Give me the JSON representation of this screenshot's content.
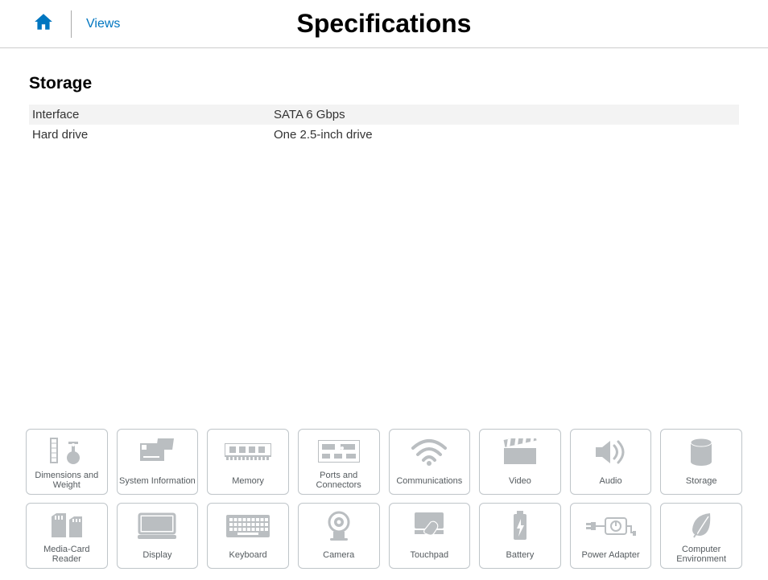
{
  "header": {
    "views_link": "Views",
    "title": "Specifications"
  },
  "section": {
    "title": "Storage",
    "rows": [
      {
        "key": "Interface",
        "value": "SATA 6 Gbps"
      },
      {
        "key": "Hard drive",
        "value": "One 2.5-inch drive"
      }
    ]
  },
  "nav": {
    "row1": [
      {
        "label": "Dimensions and Weight",
        "icon": "dimensions-weight-icon"
      },
      {
        "label": "System Information",
        "icon": "system-info-icon"
      },
      {
        "label": "Memory",
        "icon": "memory-icon"
      },
      {
        "label": "Ports and Connectors",
        "icon": "ports-icon"
      },
      {
        "label": "Communications",
        "icon": "wifi-icon"
      },
      {
        "label": "Video",
        "icon": "video-icon"
      },
      {
        "label": "Audio",
        "icon": "audio-icon"
      },
      {
        "label": "Storage",
        "icon": "storage-icon"
      }
    ],
    "row2": [
      {
        "label": "Media-Card Reader",
        "icon": "media-card-icon"
      },
      {
        "label": "Display",
        "icon": "display-icon"
      },
      {
        "label": "Keyboard",
        "icon": "keyboard-icon"
      },
      {
        "label": "Camera",
        "icon": "camera-icon"
      },
      {
        "label": "Touchpad",
        "icon": "touchpad-icon"
      },
      {
        "label": "Battery",
        "icon": "battery-icon"
      },
      {
        "label": "Power Adapter",
        "icon": "power-adapter-icon"
      },
      {
        "label": "Computer Environment",
        "icon": "environment-icon"
      }
    ]
  },
  "icons": {
    "dimensions-weight-icon": "dim",
    "system-info-icon": "sys",
    "memory-icon": "mem",
    "ports-icon": "ports",
    "wifi-icon": "wifi",
    "video-icon": "clap",
    "audio-icon": "spk",
    "storage-icon": "cyl",
    "media-card-icon": "sd",
    "display-icon": "disp",
    "keyboard-icon": "kbd",
    "camera-icon": "cam",
    "touchpad-icon": "tpad",
    "battery-icon": "bat",
    "power-adapter-icon": "pad",
    "environment-icon": "leaf"
  }
}
